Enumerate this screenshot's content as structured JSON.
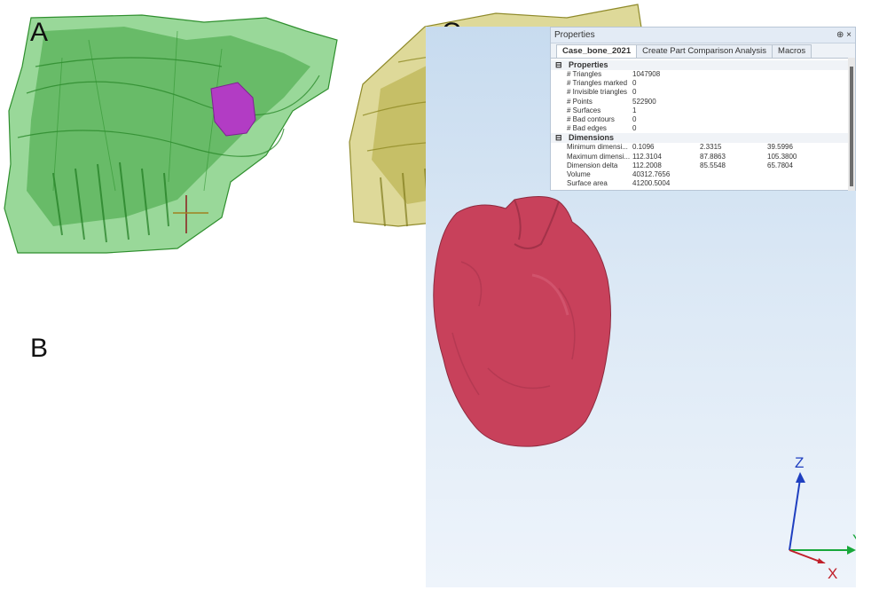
{
  "panels": {
    "a": "A",
    "b": "B",
    "c": "C"
  },
  "properties_window": {
    "title": "Properties",
    "title_icons": "⊕ ×",
    "tabs": [
      {
        "label": "Case_bone_2021",
        "active": true
      },
      {
        "label": "Create Part Comparison Analysis",
        "active": false
      },
      {
        "label": "Macros",
        "active": false
      }
    ],
    "sections": {
      "properties": {
        "header": "Properties",
        "toggle": "⊟",
        "rows": [
          {
            "label": "# Triangles",
            "value": "1047908"
          },
          {
            "label": "# Triangles marked",
            "value": "0"
          },
          {
            "label": "# Invisible triangles",
            "value": "0"
          },
          {
            "label": "# Points",
            "value": "522900"
          },
          {
            "label": "# Surfaces",
            "value": "1"
          },
          {
            "label": "# Bad contours",
            "value": "0"
          },
          {
            "label": "# Bad edges",
            "value": "0"
          }
        ]
      },
      "dimensions": {
        "header": "Dimensions",
        "toggle": "⊟",
        "rows": [
          {
            "label": "Minimum dimensi...",
            "v1": "0.1096",
            "v2": "2.3315",
            "v3": "39.5996"
          },
          {
            "label": "Maximum dimensi...",
            "v1": "112.3104",
            "v2": "87.8863",
            "v3": "105.3800"
          },
          {
            "label": "Dimension delta",
            "v1": "112.2008",
            "v2": "85.5548",
            "v3": "65.7804"
          },
          {
            "label": "Volume",
            "v1": "40312.7656",
            "v2": "",
            "v3": ""
          },
          {
            "label": "Surface area",
            "v1": "41200.5004",
            "v2": "",
            "v3": ""
          }
        ]
      }
    }
  },
  "axes": {
    "z": "Z",
    "x": "X",
    "y": "Y"
  },
  "colors": {
    "bone_green": "#3fae3a",
    "lesion_magenta": "#b23cc4",
    "bone_yellow": "#b9b23a",
    "lesion_cyan": "#2fb7d6",
    "model_red": "#c8415b",
    "axis_blue": "#1f3fc0",
    "axis_red": "#c0202a",
    "axis_green": "#18a83a"
  }
}
